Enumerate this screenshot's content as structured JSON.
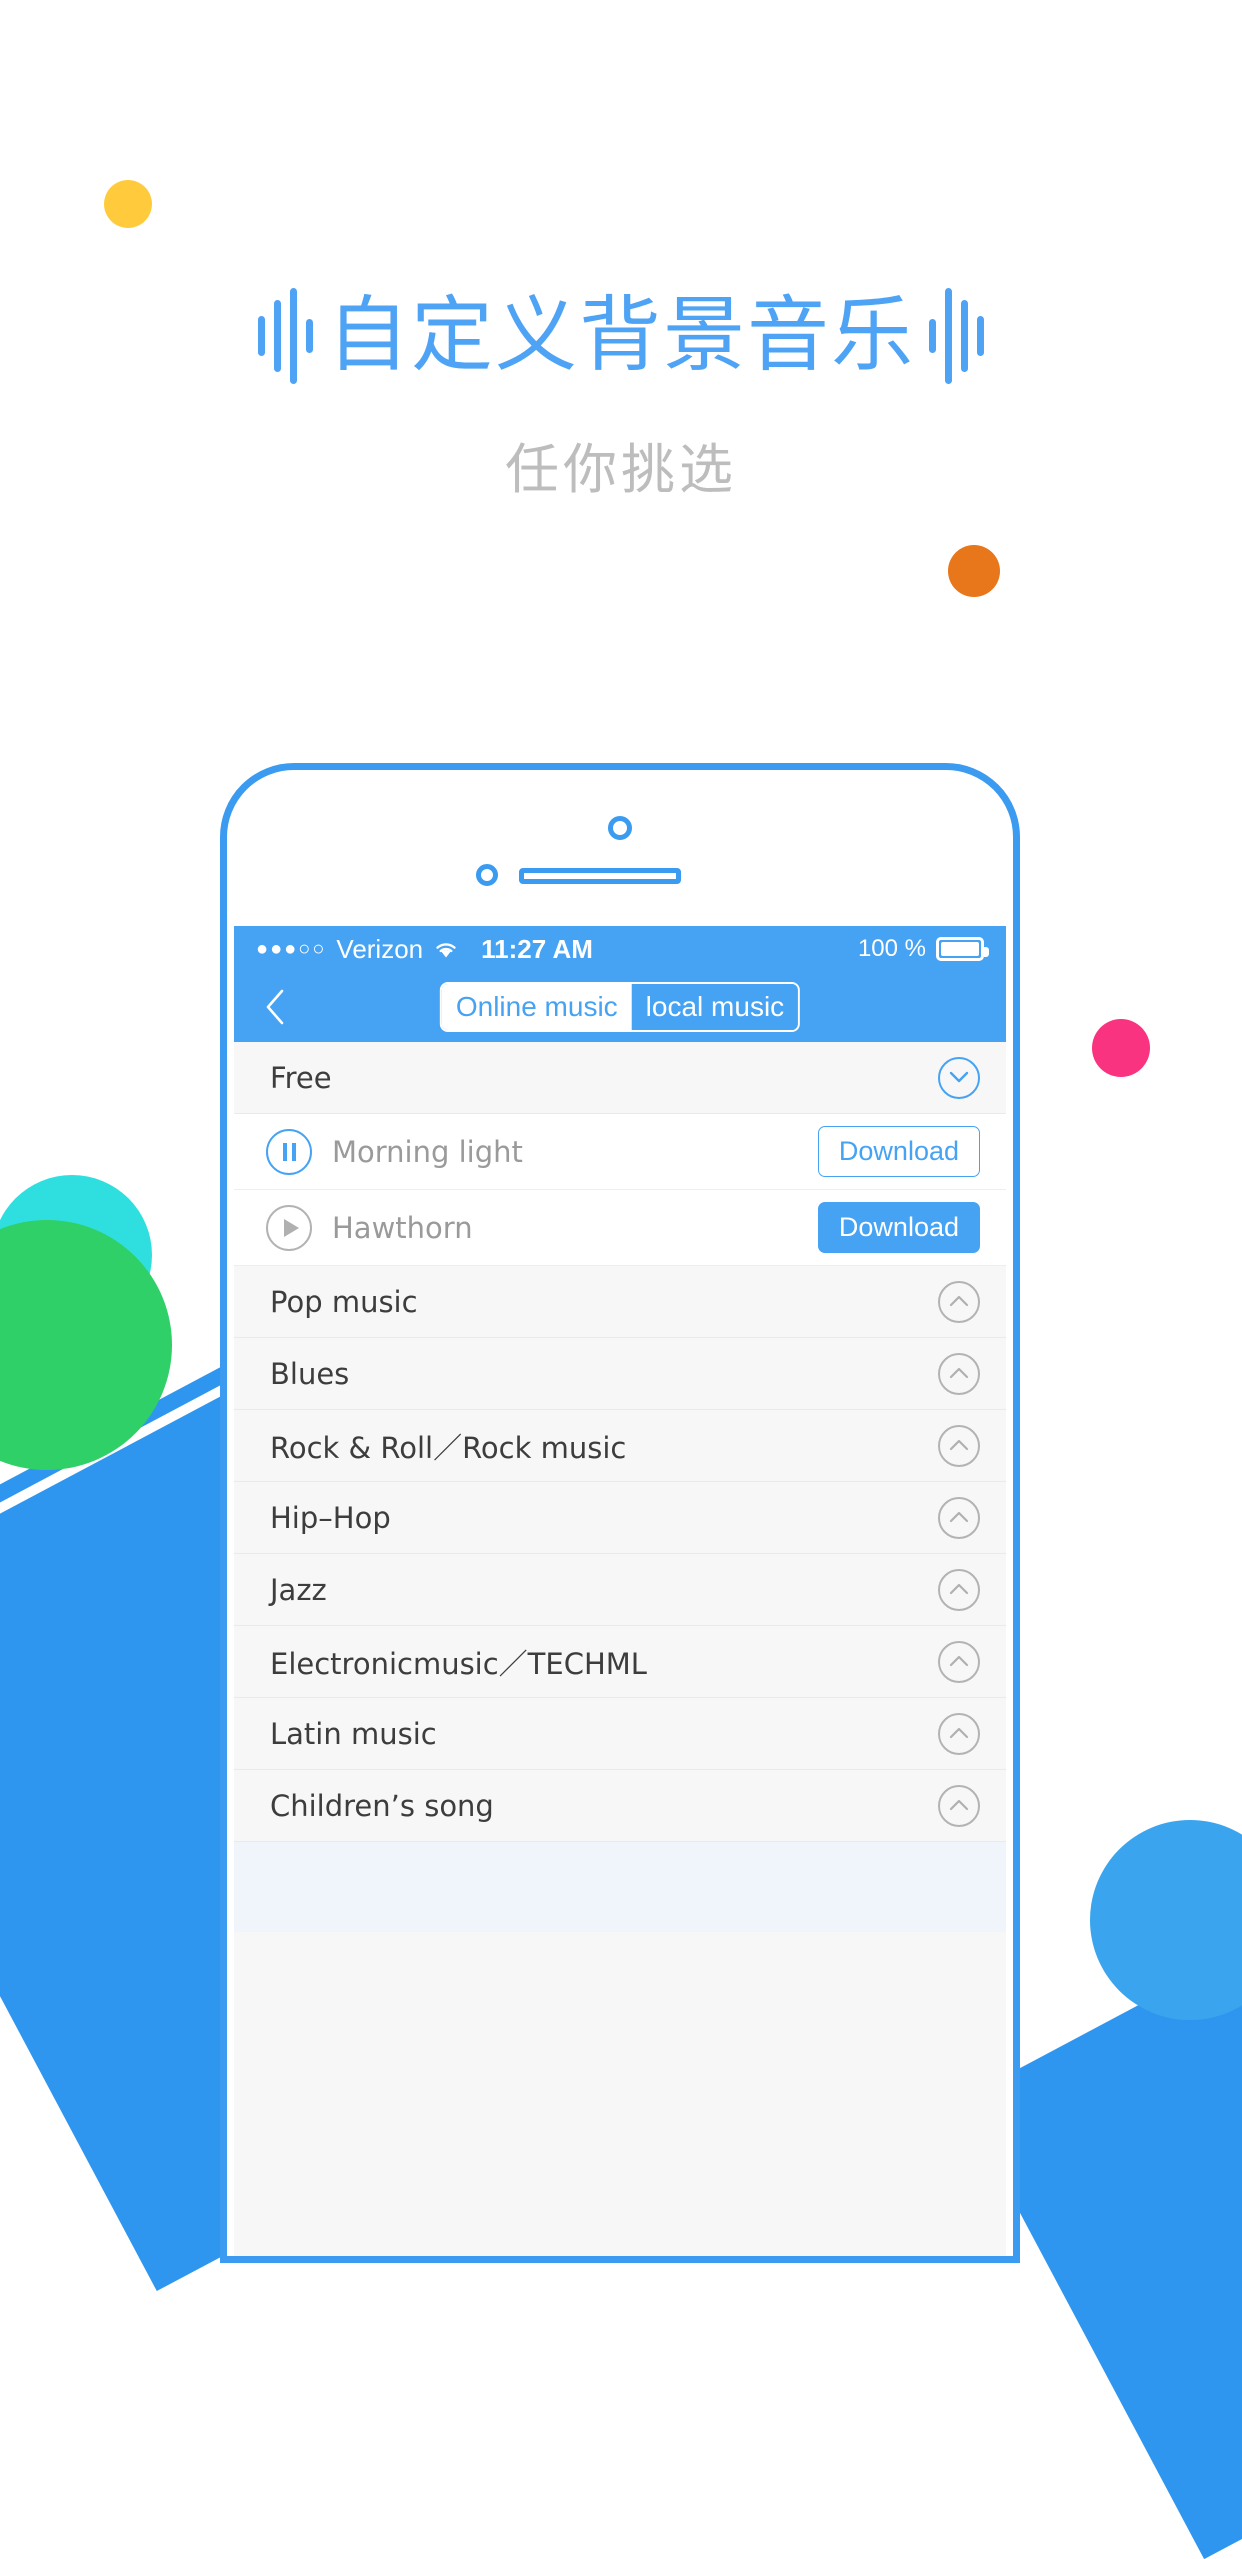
{
  "colors": {
    "brand_blue": "#46a3f3",
    "headline_blue": "#4ea3f5",
    "subhead_gray": "#bdbdbd",
    "dot_yellow": "#ffcb3d",
    "dot_orange": "#e8761a",
    "dot_pink": "#f9337f",
    "dot_cyan": "#2fdfdf",
    "dot_green": "#2fd067",
    "dot_blue": "#3aa5ee"
  },
  "hero": {
    "headline": "自定义背景音乐",
    "subhead": "任你挑选",
    "equalizer_icon_left": "equalizer-bars-icon",
    "equalizer_icon_right": "equalizer-bars-icon"
  },
  "phone": {
    "camera_icon": "front-camera-icon",
    "sensor_icon": "proximity-sensor-icon",
    "speaker_icon": "earpiece-speaker-icon"
  },
  "statusbar": {
    "signal_dots": "●●●○○",
    "carrier": "Verizon",
    "wifi_icon": "wifi-icon",
    "time": "11:27 AM",
    "battery_percent": "100 %",
    "battery_icon": "battery-full-icon"
  },
  "navbar": {
    "back_icon": "chevron-left-icon",
    "tabs": [
      {
        "label": "Online music",
        "selected": false
      },
      {
        "label": "local music",
        "selected": true
      }
    ]
  },
  "sections": {
    "free": {
      "label": "Free",
      "toggle_icon": "chevron-down-circle-icon"
    }
  },
  "songs": [
    {
      "title": "Morning light",
      "state_icon": "pause-circle-icon",
      "download_label": "Download",
      "download_style": "outline"
    },
    {
      "title": "Hawthorn",
      "state_icon": "play-circle-icon",
      "download_label": "Download",
      "download_style": "filled"
    }
  ],
  "genres": [
    {
      "label": "Pop music",
      "toggle_icon": "chevron-up-circle-icon"
    },
    {
      "label": "Blues",
      "toggle_icon": "chevron-up-circle-icon"
    },
    {
      "label": "Rock & Roll／Rock music",
      "toggle_icon": "chevron-up-circle-icon"
    },
    {
      "label": "Hip–Hop",
      "toggle_icon": "chevron-up-circle-icon"
    },
    {
      "label": "Jazz",
      "toggle_icon": "chevron-up-circle-icon"
    },
    {
      "label": "Electronicmusic／TECHML",
      "toggle_icon": "chevron-up-circle-icon"
    },
    {
      "label": "Latin music",
      "toggle_icon": "chevron-up-circle-icon"
    },
    {
      "label": "Children’s song",
      "toggle_icon": "chevron-up-circle-icon"
    }
  ]
}
